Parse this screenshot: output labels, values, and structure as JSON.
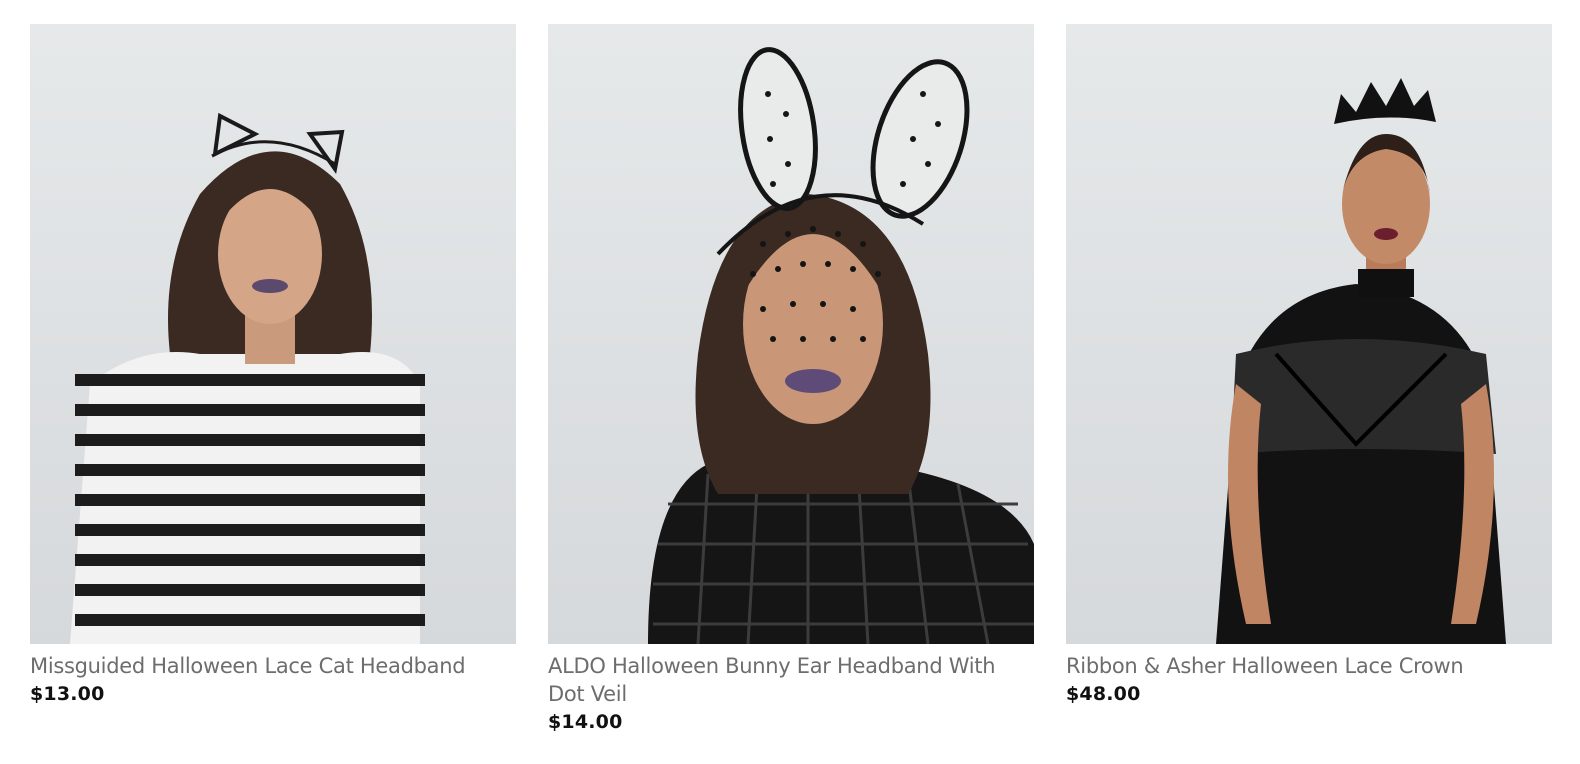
{
  "products": [
    {
      "name": "Missguided Halloween Lace Cat Headband",
      "price": "$13.00",
      "image_alt": "model wearing lace cat ear headband and striped sweater"
    },
    {
      "name": "ALDO Halloween Bunny Ear Headband With Dot Veil",
      "price": "$14.00",
      "image_alt": "model wearing polka dot bunny ear headband with veil"
    },
    {
      "name": "Ribbon & Asher Halloween Lace Crown",
      "price": "$48.00",
      "image_alt": "model wearing black lace crown and lace dress"
    }
  ],
  "colors": {
    "name_text": "#6d6d6d",
    "price_text": "#111111",
    "background": "#ffffff"
  }
}
